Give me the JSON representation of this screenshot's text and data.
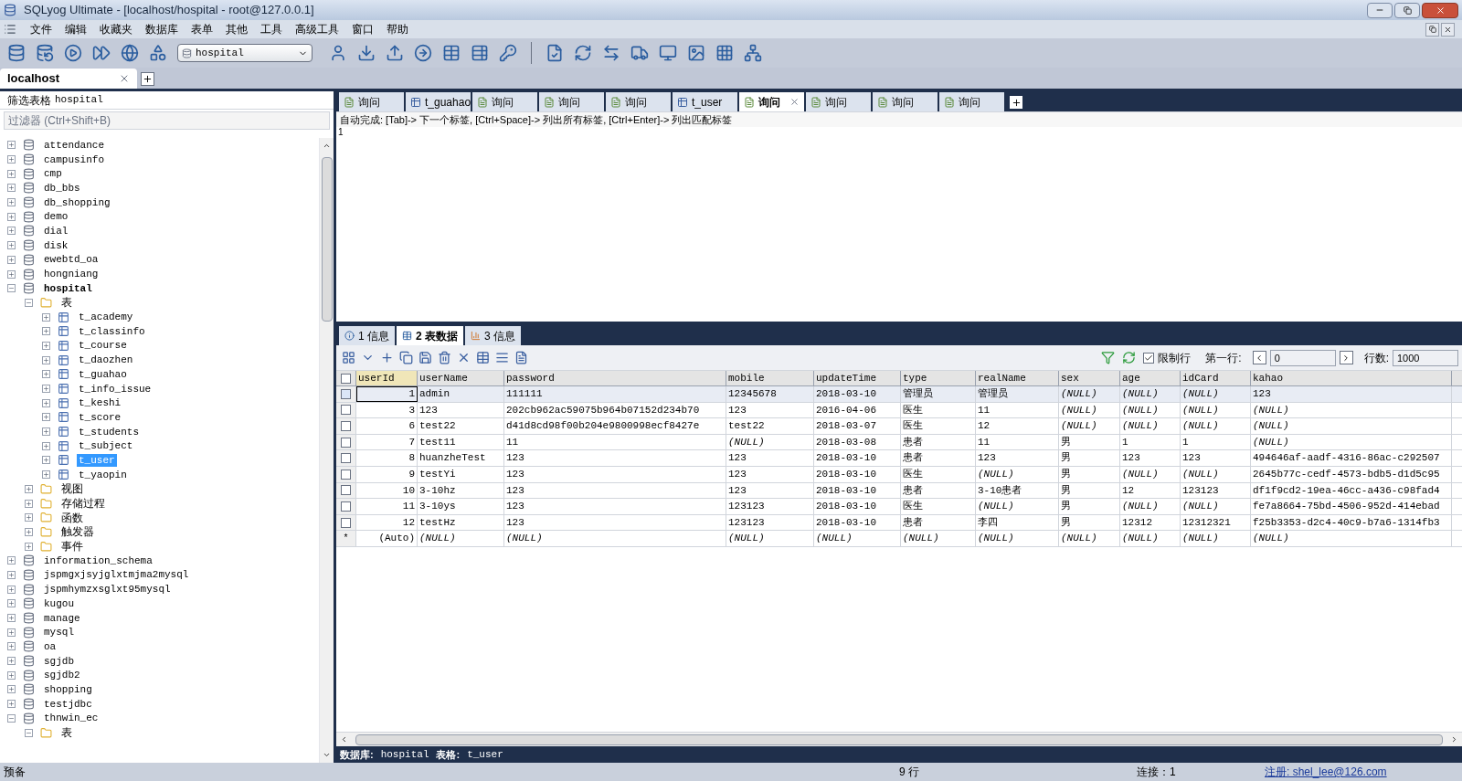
{
  "window": {
    "title": "SQLyog Ultimate - [localhost/hospital - root@127.0.0.1]"
  },
  "menu": [
    "文件",
    "编辑",
    "收藏夹",
    "数据库",
    "表单",
    "其他",
    "工具",
    "高级工具",
    "窗口",
    "帮助"
  ],
  "toolbar": {
    "database_select": "hospital"
  },
  "connection_tabs": [
    {
      "label": "localhost",
      "selected": true
    }
  ],
  "sidebar": {
    "filter_label": "筛选表格",
    "filter_db": "hospital",
    "filter_placeholder": "过滤器 (Ctrl+Shift+B)",
    "tree": [
      {
        "kind": "database",
        "label": "attendance",
        "expanded": false,
        "current": false,
        "selected": false
      },
      {
        "kind": "database",
        "label": "campusinfo",
        "expanded": false,
        "current": false,
        "selected": false
      },
      {
        "kind": "database",
        "label": "cmp",
        "expanded": false,
        "current": false,
        "selected": false
      },
      {
        "kind": "database",
        "label": "db_bbs",
        "expanded": false,
        "current": false,
        "selected": false
      },
      {
        "kind": "database",
        "label": "db_shopping",
        "expanded": false,
        "current": false,
        "selected": false
      },
      {
        "kind": "database",
        "label": "demo",
        "expanded": false,
        "current": false,
        "selected": false
      },
      {
        "kind": "database",
        "label": "dial",
        "expanded": false,
        "current": false,
        "selected": false
      },
      {
        "kind": "database",
        "label": "disk",
        "expanded": false,
        "current": false,
        "selected": false
      },
      {
        "kind": "database",
        "label": "ewebtd_oa",
        "expanded": false,
        "current": false,
        "selected": false
      },
      {
        "kind": "database",
        "label": "hongniang",
        "expanded": false,
        "current": false,
        "selected": false
      },
      {
        "kind": "database",
        "label": "hospital",
        "expanded": true,
        "current": true,
        "selected": false,
        "children": [
          {
            "kind": "folder",
            "label": "表",
            "expanded": true,
            "current": false,
            "selected": false,
            "children": [
              {
                "kind": "table",
                "label": "t_academy",
                "expanded": false,
                "current": false,
                "selected": false
              },
              {
                "kind": "table",
                "label": "t_classinfo",
                "expanded": false,
                "current": false,
                "selected": false
              },
              {
                "kind": "table",
                "label": "t_course",
                "expanded": false,
                "current": false,
                "selected": false
              },
              {
                "kind": "table",
                "label": "t_daozhen",
                "expanded": false,
                "current": false,
                "selected": false
              },
              {
                "kind": "table",
                "label": "t_guahao",
                "expanded": false,
                "current": false,
                "selected": false
              },
              {
                "kind": "table",
                "label": "t_info_issue",
                "expanded": false,
                "current": false,
                "selected": false
              },
              {
                "kind": "table",
                "label": "t_keshi",
                "expanded": false,
                "current": false,
                "selected": false
              },
              {
                "kind": "table",
                "label": "t_score",
                "expanded": false,
                "current": false,
                "selected": false
              },
              {
                "kind": "table",
                "label": "t_students",
                "expanded": false,
                "current": false,
                "selected": false
              },
              {
                "kind": "table",
                "label": "t_subject",
                "expanded": false,
                "current": false,
                "selected": false
              },
              {
                "kind": "table",
                "label": "t_user",
                "expanded": false,
                "current": false,
                "selected": true
              },
              {
                "kind": "table",
                "label": "t_yaopin",
                "expanded": false,
                "current": false,
                "selected": false
              }
            ]
          },
          {
            "kind": "folder",
            "label": "视图",
            "expanded": false,
            "current": false,
            "selected": false
          },
          {
            "kind": "folder",
            "label": "存储过程",
            "expanded": false,
            "current": false,
            "selected": false
          },
          {
            "kind": "folder",
            "label": "函数",
            "expanded": false,
            "current": false,
            "selected": false
          },
          {
            "kind": "folder",
            "label": "触发器",
            "expanded": false,
            "current": false,
            "selected": false
          },
          {
            "kind": "folder",
            "label": "事件",
            "expanded": false,
            "current": false,
            "selected": false
          }
        ]
      },
      {
        "kind": "database",
        "label": "information_schema",
        "expanded": false,
        "current": false,
        "selected": false
      },
      {
        "kind": "database",
        "label": "jspmgxjsyjglxtmjma2mysql",
        "expanded": false,
        "current": false,
        "selected": false
      },
      {
        "kind": "database",
        "label": "jspmhymzxsglxt95mysql",
        "expanded": false,
        "current": false,
        "selected": false
      },
      {
        "kind": "database",
        "label": "kugou",
        "expanded": false,
        "current": false,
        "selected": false
      },
      {
        "kind": "database",
        "label": "manage",
        "expanded": false,
        "current": false,
        "selected": false
      },
      {
        "kind": "database",
        "label": "mysql",
        "expanded": false,
        "current": false,
        "selected": false
      },
      {
        "kind": "database",
        "label": "oa",
        "expanded": false,
        "current": false,
        "selected": false
      },
      {
        "kind": "database",
        "label": "sgjdb",
        "expanded": false,
        "current": false,
        "selected": false
      },
      {
        "kind": "database",
        "label": "sgjdb2",
        "expanded": false,
        "current": false,
        "selected": false
      },
      {
        "kind": "database",
        "label": "shopping",
        "expanded": false,
        "current": false,
        "selected": false
      },
      {
        "kind": "database",
        "label": "testjdbc",
        "expanded": false,
        "current": false,
        "selected": false
      },
      {
        "kind": "database",
        "label": "thnwin_ec",
        "expanded": true,
        "current": false,
        "selected": false,
        "children": [
          {
            "kind": "folder",
            "label": "表",
            "expanded": true,
            "current": false,
            "selected": false
          }
        ]
      }
    ]
  },
  "query_tabs": [
    {
      "kind": "query",
      "label": "询问",
      "selected": false
    },
    {
      "kind": "table",
      "label": "t_guahao",
      "selected": false
    },
    {
      "kind": "query",
      "label": "询问",
      "selected": false
    },
    {
      "kind": "query",
      "label": "询问",
      "selected": false
    },
    {
      "kind": "query",
      "label": "询问",
      "selected": false
    },
    {
      "kind": "table",
      "label": "t_user",
      "selected": false
    },
    {
      "kind": "query",
      "label": "询问",
      "selected": true
    },
    {
      "kind": "query",
      "label": "询问",
      "selected": false
    },
    {
      "kind": "query",
      "label": "询问",
      "selected": false
    },
    {
      "kind": "query",
      "label": "询问",
      "selected": false
    }
  ],
  "editor": {
    "hint": "自动完成: [Tab]-> 下一个标签, [Ctrl+Space]-> 列出所有标签, [Ctrl+Enter]-> 列出匹配标签",
    "line_numbers": [
      "1"
    ]
  },
  "result_tabs": [
    {
      "kind": "info",
      "label": "1 信息",
      "selected": false
    },
    {
      "kind": "data",
      "label": "2 表数据",
      "selected": true
    },
    {
      "kind": "chart",
      "label": "3 信息",
      "selected": false
    }
  ],
  "grid_toolbar": {
    "limit_label": "限制行",
    "limit_checked": true,
    "first_row_label": "第一行:",
    "first_row": "0",
    "rows_label": "行数:",
    "rows": "1000"
  },
  "table": {
    "columns": [
      "userId",
      "userName",
      "password",
      "mobile",
      "updateTime",
      "type",
      "realName",
      "sex",
      "age",
      "idCard",
      "kahao"
    ],
    "all_selected": false,
    "rows": [
      {
        "kind": "data",
        "selected": true,
        "cells": [
          {
            "text": "1",
            "null": false
          },
          {
            "text": "admin",
            "null": false
          },
          {
            "text": "111111",
            "null": false
          },
          {
            "text": "12345678",
            "null": false
          },
          {
            "text": "2018-03-10",
            "null": false
          },
          {
            "text": "管理员",
            "null": false
          },
          {
            "text": "管理员",
            "null": false
          },
          {
            "text": "(NULL)",
            "null": true
          },
          {
            "text": "(NULL)",
            "null": true
          },
          {
            "text": "(NULL)",
            "null": true
          },
          {
            "text": "123",
            "null": false
          }
        ]
      },
      {
        "kind": "data",
        "selected": false,
        "cells": [
          {
            "text": "3",
            "null": false
          },
          {
            "text": "123",
            "null": false
          },
          {
            "text": "202cb962ac59075b964b07152d234b70",
            "null": false
          },
          {
            "text": "123",
            "null": false
          },
          {
            "text": "2016-04-06",
            "null": false
          },
          {
            "text": "医生",
            "null": false
          },
          {
            "text": "11",
            "null": false
          },
          {
            "text": "(NULL)",
            "null": true
          },
          {
            "text": "(NULL)",
            "null": true
          },
          {
            "text": "(NULL)",
            "null": true
          },
          {
            "text": "(NULL)",
            "null": true
          }
        ]
      },
      {
        "kind": "data",
        "selected": false,
        "cells": [
          {
            "text": "6",
            "null": false
          },
          {
            "text": "test22",
            "null": false
          },
          {
            "text": "d41d8cd98f00b204e9800998ecf8427e",
            "null": false
          },
          {
            "text": "test22",
            "null": false
          },
          {
            "text": "2018-03-07",
            "null": false
          },
          {
            "text": "医生",
            "null": false
          },
          {
            "text": "12",
            "null": false
          },
          {
            "text": "(NULL)",
            "null": true
          },
          {
            "text": "(NULL)",
            "null": true
          },
          {
            "text": "(NULL)",
            "null": true
          },
          {
            "text": "(NULL)",
            "null": true
          }
        ]
      },
      {
        "kind": "data",
        "selected": false,
        "cells": [
          {
            "text": "7",
            "null": false
          },
          {
            "text": "test11",
            "null": false
          },
          {
            "text": "11",
            "null": false
          },
          {
            "text": "(NULL)",
            "null": true
          },
          {
            "text": "2018-03-08",
            "null": false
          },
          {
            "text": "患者",
            "null": false
          },
          {
            "text": "11",
            "null": false
          },
          {
            "text": "男",
            "null": false
          },
          {
            "text": "1",
            "null": false
          },
          {
            "text": "1",
            "null": false
          },
          {
            "text": "(NULL)",
            "null": true
          }
        ]
      },
      {
        "kind": "data",
        "selected": false,
        "cells": [
          {
            "text": "8",
            "null": false
          },
          {
            "text": "huanzheTest",
            "null": false
          },
          {
            "text": "123",
            "null": false
          },
          {
            "text": "123",
            "null": false
          },
          {
            "text": "2018-03-10",
            "null": false
          },
          {
            "text": "患者",
            "null": false
          },
          {
            "text": "123",
            "null": false
          },
          {
            "text": "男",
            "null": false
          },
          {
            "text": "123",
            "null": false
          },
          {
            "text": "123",
            "null": false
          },
          {
            "text": "494646af-aadf-4316-86ac-c292507",
            "null": false
          }
        ]
      },
      {
        "kind": "data",
        "selected": false,
        "cells": [
          {
            "text": "9",
            "null": false
          },
          {
            "text": "testYi",
            "null": false
          },
          {
            "text": "123",
            "null": false
          },
          {
            "text": "123",
            "null": false
          },
          {
            "text": "2018-03-10",
            "null": false
          },
          {
            "text": "医生",
            "null": false
          },
          {
            "text": "(NULL)",
            "null": true
          },
          {
            "text": "男",
            "null": false
          },
          {
            "text": "(NULL)",
            "null": true
          },
          {
            "text": "(NULL)",
            "null": true
          },
          {
            "text": "2645b77c-cedf-4573-bdb5-d1d5c95",
            "null": false
          }
        ]
      },
      {
        "kind": "data",
        "selected": false,
        "cells": [
          {
            "text": "10",
            "null": false
          },
          {
            "text": "3-10hz",
            "null": false
          },
          {
            "text": "123",
            "null": false
          },
          {
            "text": "123",
            "null": false
          },
          {
            "text": "2018-03-10",
            "null": false
          },
          {
            "text": "患者",
            "null": false
          },
          {
            "text": "3-10患者",
            "null": false
          },
          {
            "text": "男",
            "null": false
          },
          {
            "text": "12",
            "null": false
          },
          {
            "text": "123123",
            "null": false
          },
          {
            "text": "df1f9cd2-19ea-46cc-a436-c98fad4",
            "null": false
          }
        ]
      },
      {
        "kind": "data",
        "selected": false,
        "cells": [
          {
            "text": "11",
            "null": false
          },
          {
            "text": "3-10ys",
            "null": false
          },
          {
            "text": "123",
            "null": false
          },
          {
            "text": "123123",
            "null": false
          },
          {
            "text": "2018-03-10",
            "null": false
          },
          {
            "text": "医生",
            "null": false
          },
          {
            "text": "(NULL)",
            "null": true
          },
          {
            "text": "男",
            "null": false
          },
          {
            "text": "(NULL)",
            "null": true
          },
          {
            "text": "(NULL)",
            "null": true
          },
          {
            "text": "fe7a8664-75bd-4506-952d-414ebad",
            "null": false
          }
        ]
      },
      {
        "kind": "data",
        "selected": false,
        "cells": [
          {
            "text": "12",
            "null": false
          },
          {
            "text": "testHz",
            "null": false
          },
          {
            "text": "123",
            "null": false
          },
          {
            "text": "123123",
            "null": false
          },
          {
            "text": "2018-03-10",
            "null": false
          },
          {
            "text": "患者",
            "null": false
          },
          {
            "text": "李四",
            "null": false
          },
          {
            "text": "男",
            "null": false
          },
          {
            "text": "12312",
            "null": false
          },
          {
            "text": "12312321",
            "null": false
          },
          {
            "text": "f25b3353-d2c4-40c9-b7a6-1314fb3",
            "null": false
          }
        ]
      },
      {
        "kind": "new",
        "marker": "*",
        "cells": [
          {
            "text": "(Auto)",
            "null": false
          },
          {
            "text": "(NULL)",
            "null": true
          },
          {
            "text": "(NULL)",
            "null": true
          },
          {
            "text": "(NULL)",
            "null": true
          },
          {
            "text": "(NULL)",
            "null": true
          },
          {
            "text": "(NULL)",
            "null": true
          },
          {
            "text": "(NULL)",
            "null": true
          },
          {
            "text": "(NULL)",
            "null": true
          },
          {
            "text": "(NULL)",
            "null": true
          },
          {
            "text": "(NULL)",
            "null": true
          },
          {
            "text": "(NULL)",
            "null": true
          }
        ]
      }
    ]
  },
  "info_bar": {
    "db_label": "数据库:",
    "db": "hospital",
    "table_label": "表格:",
    "table": "t_user"
  },
  "status_bar": {
    "state": "预备",
    "rows": "9 行",
    "connections": "连接：1",
    "register": "注册: shel_lee@126.com"
  }
}
